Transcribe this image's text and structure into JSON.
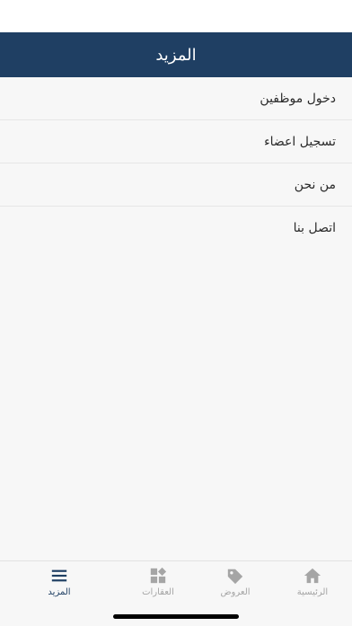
{
  "header": {
    "title": "المزيد"
  },
  "menu": {
    "items": [
      {
        "label": "دخول موظفين"
      },
      {
        "label": "تسجيل اعضاء"
      },
      {
        "label": "من نحن"
      },
      {
        "label": "اتصل بنا"
      }
    ]
  },
  "tabbar": {
    "tabs": [
      {
        "label": "الرئيسية",
        "icon": "home-icon",
        "active": false
      },
      {
        "label": "العروض",
        "icon": "tag-icon",
        "active": false
      },
      {
        "label": "العقارات",
        "icon": "grid-icon",
        "active": false
      },
      {
        "label": "المزيد",
        "icon": "menu-icon",
        "active": true
      }
    ]
  },
  "colors": {
    "header_bg": "#1f3f63",
    "active_tab": "#1f3f63",
    "inactive_tab": "#a5a5a5",
    "background": "#f7f7f7"
  }
}
